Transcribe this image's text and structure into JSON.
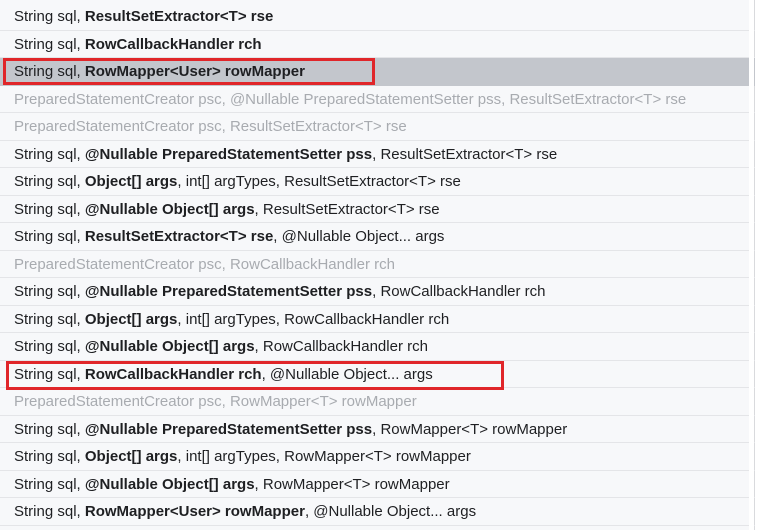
{
  "rows": [
    {
      "segments": [
        {
          "t": "String sql, ",
          "b": false
        },
        {
          "t": "ResultSetExtractor<T> rse",
          "b": true
        }
      ],
      "state": "normal"
    },
    {
      "segments": [
        {
          "t": "String sql, ",
          "b": false
        },
        {
          "t": "RowCallbackHandler rch",
          "b": true
        }
      ],
      "state": "normal"
    },
    {
      "segments": [
        {
          "t": "String sql, ",
          "b": false
        },
        {
          "t": "RowMapper<User> rowMapper",
          "b": true
        }
      ],
      "state": "selected"
    },
    {
      "segments": [
        {
          "t": "PreparedStatementCreator psc, @Nullable PreparedStatementSetter pss, ResultSetExtractor<T> rse",
          "b": false
        }
      ],
      "state": "disabled"
    },
    {
      "segments": [
        {
          "t": "PreparedStatementCreator psc, ResultSetExtractor<T> rse",
          "b": false
        }
      ],
      "state": "disabled"
    },
    {
      "segments": [
        {
          "t": "String sql, ",
          "b": false
        },
        {
          "t": "@Nullable PreparedStatementSetter pss",
          "b": true
        },
        {
          "t": ", ResultSetExtractor<T> rse",
          "b": false
        }
      ],
      "state": "normal"
    },
    {
      "segments": [
        {
          "t": "String sql, ",
          "b": false
        },
        {
          "t": "Object[] args",
          "b": true
        },
        {
          "t": ", int[] argTypes, ResultSetExtractor<T> rse",
          "b": false
        }
      ],
      "state": "normal"
    },
    {
      "segments": [
        {
          "t": "String sql, ",
          "b": false
        },
        {
          "t": "@Nullable Object[] args",
          "b": true
        },
        {
          "t": ", ResultSetExtractor<T> rse",
          "b": false
        }
      ],
      "state": "normal"
    },
    {
      "segments": [
        {
          "t": "String sql, ",
          "b": false
        },
        {
          "t": "ResultSetExtractor<T> rse",
          "b": true
        },
        {
          "t": ", @Nullable Object... args",
          "b": false
        }
      ],
      "state": "normal"
    },
    {
      "segments": [
        {
          "t": "PreparedStatementCreator psc, RowCallbackHandler rch",
          "b": false
        }
      ],
      "state": "disabled"
    },
    {
      "segments": [
        {
          "t": "String sql, ",
          "b": false
        },
        {
          "t": "@Nullable PreparedStatementSetter pss",
          "b": true
        },
        {
          "t": ", RowCallbackHandler rch",
          "b": false
        }
      ],
      "state": "normal"
    },
    {
      "segments": [
        {
          "t": "String sql, ",
          "b": false
        },
        {
          "t": "Object[] args",
          "b": true
        },
        {
          "t": ", int[] argTypes, RowCallbackHandler rch",
          "b": false
        }
      ],
      "state": "normal"
    },
    {
      "segments": [
        {
          "t": "String sql, ",
          "b": false
        },
        {
          "t": "@Nullable Object[] args",
          "b": true
        },
        {
          "t": ", RowCallbackHandler rch",
          "b": false
        }
      ],
      "state": "normal"
    },
    {
      "segments": [
        {
          "t": "String sql, ",
          "b": false
        },
        {
          "t": "RowCallbackHandler rch",
          "b": true
        },
        {
          "t": ", @Nullable Object... args",
          "b": false
        }
      ],
      "state": "normal"
    },
    {
      "segments": [
        {
          "t": "PreparedStatementCreator psc, RowMapper<T> rowMapper",
          "b": false
        }
      ],
      "state": "disabled"
    },
    {
      "segments": [
        {
          "t": "String sql, ",
          "b": false
        },
        {
          "t": "@Nullable PreparedStatementSetter pss",
          "b": true
        },
        {
          "t": ", RowMapper<T> rowMapper",
          "b": false
        }
      ],
      "state": "normal"
    },
    {
      "segments": [
        {
          "t": "String sql, ",
          "b": false
        },
        {
          "t": "Object[] args",
          "b": true
        },
        {
          "t": ", int[] argTypes, RowMapper<T> rowMapper",
          "b": false
        }
      ],
      "state": "normal"
    },
    {
      "segments": [
        {
          "t": "String sql, ",
          "b": false
        },
        {
          "t": "@Nullable Object[] args",
          "b": true
        },
        {
          "t": ", RowMapper<T> rowMapper",
          "b": false
        }
      ],
      "state": "normal"
    },
    {
      "segments": [
        {
          "t": "String sql, ",
          "b": false
        },
        {
          "t": "RowMapper<User> rowMapper",
          "b": true
        },
        {
          "t": ", @Nullable Object... args",
          "b": false
        }
      ],
      "state": "normal"
    }
  ],
  "colors": {
    "selected_bg": "#c3c6cc",
    "disabled_text": "#a8abb0",
    "highlight_border": "#e0262a"
  }
}
